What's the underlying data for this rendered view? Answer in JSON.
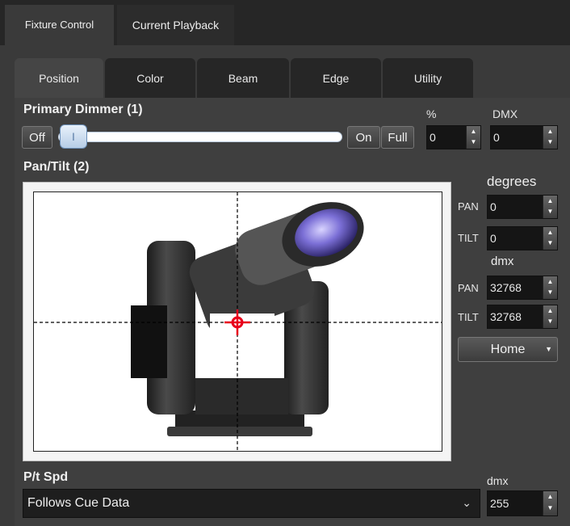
{
  "top_tabs": [
    {
      "label": "Fixture Control"
    },
    {
      "label": "Current Playback"
    }
  ],
  "sub_tabs": [
    {
      "label": "Position"
    },
    {
      "label": "Color"
    },
    {
      "label": "Beam"
    },
    {
      "label": "Edge"
    },
    {
      "label": "Utility"
    }
  ],
  "dimmer": {
    "title": "Primary Dimmer (1)",
    "off_label": "Off",
    "on_label": "On",
    "full_label": "Full",
    "slider_handle": "I",
    "level": 0,
    "percent_header": "%",
    "dmx_header": "DMX",
    "percent_value": "0",
    "dmx_value": "0"
  },
  "pantilt": {
    "title": "Pan/Tilt (2)",
    "degrees_header": "degrees",
    "pan_label": "PAN",
    "tilt_label": "TILT",
    "pan_degrees": "0",
    "tilt_degrees": "0",
    "dmx_header": "dmx",
    "pan_dmx": "32768",
    "tilt_dmx": "32768",
    "home_label": "Home",
    "crosshair": {
      "pan": 0.5,
      "tilt": 0.5
    }
  },
  "pt_speed": {
    "title": "P/t Spd",
    "selected": "Follows Cue Data",
    "dmx_header": "dmx",
    "dmx_value": "255"
  },
  "colors": {
    "background": "#3a3a3a",
    "crosshair": "#e8001c",
    "lens": "#6a5acd"
  }
}
